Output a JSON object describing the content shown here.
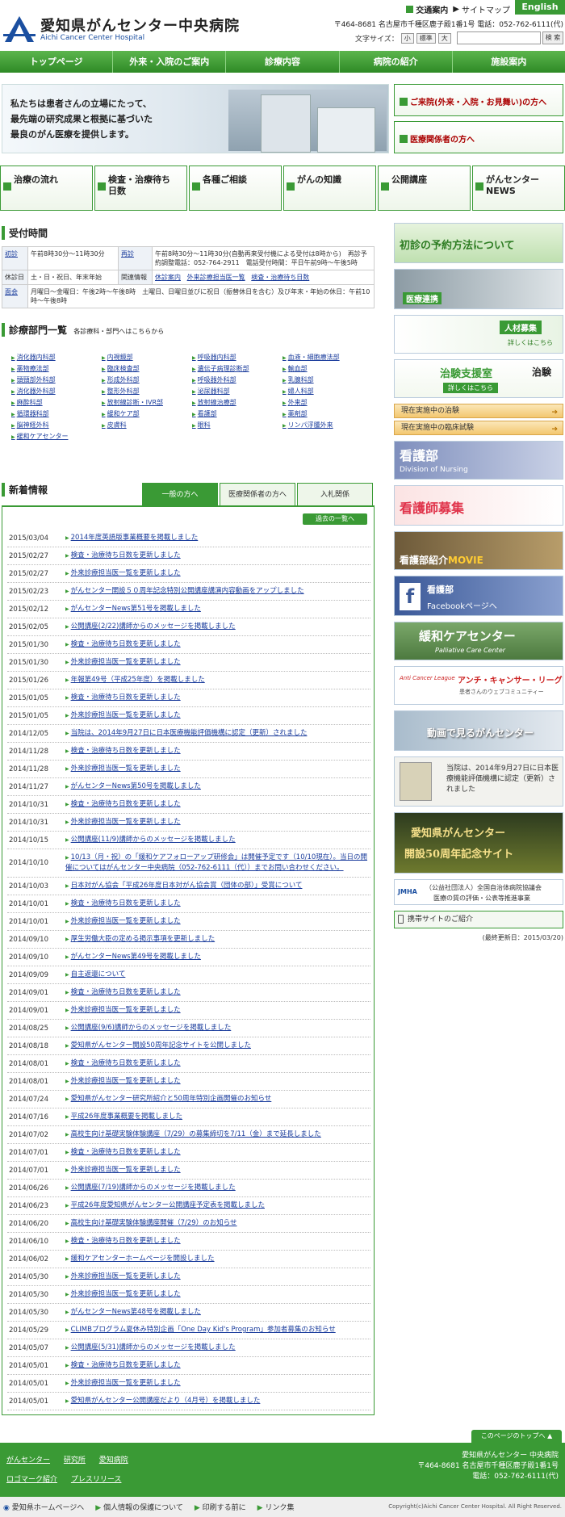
{
  "header": {
    "logo_jp": "愛知県がんセンター中央病院",
    "logo_en": "Aichi Cancer Center Hospital",
    "access_link": "交通案内",
    "sitemap_link": "サイトマップ",
    "english": "English",
    "address_line": "〒464-8681 名古屋市千種区鹿子殿1番1号 電話：052-762-6111(代)",
    "fontsize_label": "文字サイズ：",
    "fontsize_small": "小",
    "fontsize_std": "標準",
    "fontsize_large": "大",
    "search_btn": "検 索"
  },
  "gnav": [
    "トップページ",
    "外来・入院のご案内",
    "診療内容",
    "病院の紹介",
    "施設案内"
  ],
  "hero": {
    "line1": "私たちは患者さんの立場にたって、",
    "line2": "最先端の研究成果と根拠に基づいた",
    "line3": "最良のがん医療を提供します。",
    "btn_visitors": "ご来院(外来・入院・お見舞い)の方へ",
    "btn_medical": "医療関係者の方へ"
  },
  "tiles": [
    "治療の流れ",
    "検査・治療待ち日数",
    "各種ご相談",
    "がんの知識",
    "公開講座",
    "がんセンターNEWS"
  ],
  "reception": {
    "title": "受付時間",
    "r1": [
      "初診",
      "午前8時30分～11時30分",
      "再診",
      "午前8時30分～11時30分(自動再来受付機による受付は8時から)　再診予約調整電話：052-764-2911　電話受付時間：平日午前9時～午後5時"
    ],
    "r2": [
      "休診日",
      "土・日・祝日、年末年始",
      "関連情報",
      "休診案内",
      "外来診療担当医一覧",
      "検査・治療待ち日数"
    ],
    "r3": [
      "面会",
      "月曜日～金曜日：午後2時～午後8時　土曜日、日曜日並びに祝日（振替休日を含む）及び年末・年始の休日：午前10時～午後8時"
    ]
  },
  "departments": {
    "title": "診療部門一覧",
    "subtitle": "各診療科・部門へはこちらから",
    "items": [
      "消化器内科部",
      "内視鏡部",
      "呼吸器内科部",
      "血液・細胞療法部",
      "薬物療法部",
      "臨床検査部",
      "遺伝子病理診断部",
      "輸血部",
      "頭頸部外科部",
      "形成外科部",
      "呼吸器外科部",
      "乳腺科部",
      "消化器外科部",
      "整形外科部",
      "泌尿器科部",
      "婦人科部",
      "麻酔科部",
      "放射線診断・IVR部",
      "放射線治療部",
      "外来部",
      "循環器科部",
      "緩和ケア部",
      "看護部",
      "薬剤部",
      "脳神経外科",
      "皮膚科",
      "眼科",
      "リンパ浮腫外来",
      "緩和ケアセンター"
    ]
  },
  "news": {
    "title": "新着情報",
    "tabs": [
      "一般の方へ",
      "医療関係者の方へ",
      "入札関係"
    ],
    "archive": "過去の一覧へ",
    "items": [
      {
        "date": "2015/03/04",
        "text": "2014年度英語版事業概要を掲載しました"
      },
      {
        "date": "2015/02/27",
        "text": "検査・治療待ち日数を更新しました"
      },
      {
        "date": "2015/02/27",
        "text": "外来診療担当医一覧を更新しました"
      },
      {
        "date": "2015/02/23",
        "text": "がんセンター開設５０周年記念特別公開講座講演内容動画をアップしました"
      },
      {
        "date": "2015/02/12",
        "text": "がんセンターNews第51号を掲載しました"
      },
      {
        "date": "2015/02/05",
        "text": "公開講座(2/22)講師からのメッセージを掲載しました"
      },
      {
        "date": "2015/01/30",
        "text": "検査・治療待ち日数を更新しました"
      },
      {
        "date": "2015/01/30",
        "text": "外来診療担当医一覧を更新しました"
      },
      {
        "date": "2015/01/26",
        "text": "年報第49号（平成25年度）を掲載しました"
      },
      {
        "date": "2015/01/05",
        "text": "検査・治療待ち日数を更新しました"
      },
      {
        "date": "2015/01/05",
        "text": "外来診療担当医一覧を更新しました"
      },
      {
        "date": "2014/12/05",
        "text": "当院は、2014年9月27日に日本医療機能評価機構に認定（更新）されました"
      },
      {
        "date": "2014/11/28",
        "text": "検査・治療待ち日数を更新しました"
      },
      {
        "date": "2014/11/28",
        "text": "外来診療担当医一覧を更新しました"
      },
      {
        "date": "2014/11/27",
        "text": "がんセンターNews第50号を掲載しました"
      },
      {
        "date": "2014/10/31",
        "text": "検査・治療待ち日数を更新しました"
      },
      {
        "date": "2014/10/31",
        "text": "外来診療担当医一覧を更新しました"
      },
      {
        "date": "2014/10/15",
        "text": "公開講座(11/9)講師からのメッセージを掲載しました"
      },
      {
        "date": "2014/10/10",
        "text": "10/13（月・祝）の「緩和ケアフォローアップ研修会」は開催予定です（10/10現在）。当日の開催についてはがんセンター中央病院（052-762-6111（代））までお問い合わせください。"
      },
      {
        "date": "2014/10/03",
        "text": "日本対がん協会「平成26年度日本対がん協会賞（団体の部）」受賞について"
      },
      {
        "date": "2014/10/01",
        "text": "検査・治療待ち日数を更新しました"
      },
      {
        "date": "2014/10/01",
        "text": "外来診療担当医一覧を更新しました"
      },
      {
        "date": "2014/09/10",
        "text": "厚生労働大臣の定める掲示事項を更新しました"
      },
      {
        "date": "2014/09/10",
        "text": "がんセンターNews第49号を掲載しました"
      },
      {
        "date": "2014/09/09",
        "text": "自主返還について"
      },
      {
        "date": "2014/09/01",
        "text": "検査・治療待ち日数を更新しました"
      },
      {
        "date": "2014/09/01",
        "text": "外来診療担当医一覧を更新しました"
      },
      {
        "date": "2014/08/25",
        "text": "公開講座(9/6)講師からのメッセージを掲載しました"
      },
      {
        "date": "2014/08/18",
        "text": "愛知県がんセンター開設50周年記念サイトを公開しました"
      },
      {
        "date": "2014/08/01",
        "text": "検査・治療待ち日数を更新しました"
      },
      {
        "date": "2014/08/01",
        "text": "外来診療担当医一覧を更新しました"
      },
      {
        "date": "2014/07/24",
        "text": "愛知県がんセンター研究所紹介と50周年特別企画開催のお知らせ"
      },
      {
        "date": "2014/07/16",
        "text": "平成26年度事業概要を掲載しました"
      },
      {
        "date": "2014/07/02",
        "text": "高校生向け基礎実験体験講座（7/29）の募集締切を7/11（金）まで延長しました"
      },
      {
        "date": "2014/07/01",
        "text": "検査・治療待ち日数を更新しました"
      },
      {
        "date": "2014/07/01",
        "text": "外来診療担当医一覧を更新しました"
      },
      {
        "date": "2014/06/26",
        "text": "公開講座(7/19)講師からのメッセージを掲載しました"
      },
      {
        "date": "2014/06/23",
        "text": "平成26年度愛知県がんセンター公開講座予定表を掲載しました"
      },
      {
        "date": "2014/06/20",
        "text": "高校生向け基礎実験体験講座開催（7/29）のお知らせ"
      },
      {
        "date": "2014/06/10",
        "text": "検査・治療待ち日数を更新しました"
      },
      {
        "date": "2014/06/02",
        "text": "緩和ケアセンターホームページを開設しました"
      },
      {
        "date": "2014/05/30",
        "text": "外来診療担当医一覧を更新しました"
      },
      {
        "date": "2014/05/30",
        "text": "外来診療担当医一覧を更新しました"
      },
      {
        "date": "2014/05/30",
        "text": "がんセンターNews第48号を掲載しました"
      },
      {
        "date": "2014/05/29",
        "text": "CLIMBプログラム夏休み特別企画「One Day Kid's Program」参加者募集のお知らせ"
      },
      {
        "date": "2014/05/07",
        "text": "公開講座(5/31)講師からのメッセージを掲載しました"
      },
      {
        "date": "2014/05/01",
        "text": "検査・治療待ち日数を更新しました"
      },
      {
        "date": "2014/05/01",
        "text": "外来診療担当医一覧を更新しました"
      },
      {
        "date": "2014/05/01",
        "text": "愛知県がんセンター公開講座だより（4月号）を掲載しました"
      }
    ]
  },
  "sidebar": {
    "yoyaku": "初診の予約方法について",
    "renkei": "医療連携",
    "jinzai": "人材募集",
    "jinzai_sub": "詳しくはこちら",
    "chiken": "治験支援室",
    "chiken_right": "治験",
    "chiken_sub": "詳しくはこちら",
    "current_trials": "現在実施中の治験",
    "current_clinical": "現在実施中の臨床試験",
    "kango": "看護部",
    "kango_en": "Division of Nursing",
    "kango_boshu": "看護師募集",
    "kango_movie": "看護部紹介",
    "kango_movie_red": "MOVIE",
    "facebook": "看護部",
    "facebook_sub": "Facebookページへ",
    "palliative": "緩和ケアセンター",
    "palliative_en": "Palliative Care Center",
    "acl": "アンチ・キャンサー・リーグ",
    "acl_sub": "患者さんのウェブコミュニティー",
    "acl_logo": "Anti Cancer League",
    "video": "動画で見るがんセンター",
    "accredit": "当院は、2014年9月27日に日本医療機能評価機構に認定（更新）されました",
    "anniv1": "愛知県がんセンター",
    "anniv2": "開設50周年記念サイト",
    "jmha": "（公益社団法人）全国自治体病院協議会",
    "jmha_sub": "医療の質の評価・公表等推進事業",
    "jmha_logo": "JMHA",
    "mobile": "携帯サイトのご紹介",
    "updated": "(最終更新日：2015/03/20)"
  },
  "footer": {
    "pagetop": "このページのトップへ ▲",
    "links1": [
      "がんセンター",
      "研究所",
      "愛知病院"
    ],
    "links2": [
      "ロゴマーク紹介",
      "プレスリリース"
    ],
    "addr1": "愛知県がんセンター 中央病院",
    "addr2": "〒464-8681 名古屋市千種区鹿子殿1番1号",
    "addr3": "電話：052-762-6111(代)",
    "bottom_links": [
      "愛知県ホームページへ",
      "個人情報の保護について",
      "印刷する前に",
      "リンク集"
    ],
    "copyright": "Copyright(c)Aichi Cancer Center Hospital. All Right Reserved."
  },
  "colors": {
    "brand_green": "#3a9a35",
    "link_blue": "#1a3c9c",
    "alert_red": "#a00000"
  }
}
